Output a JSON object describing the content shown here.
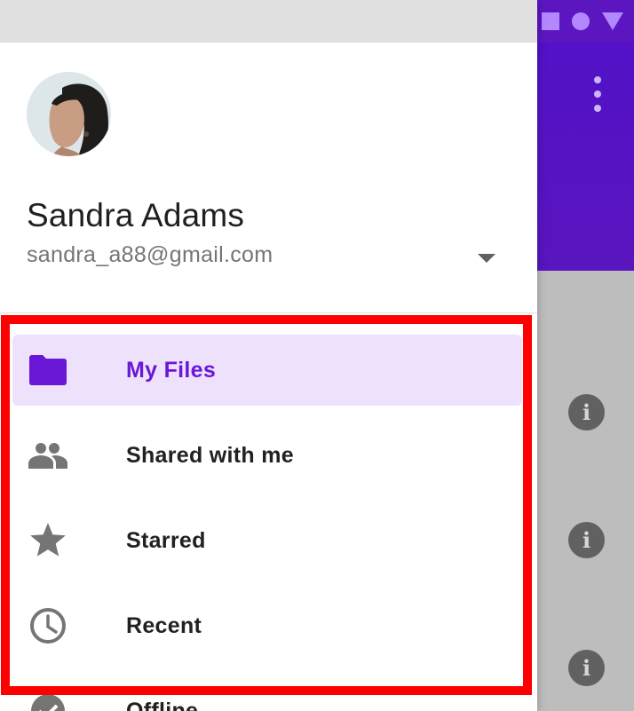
{
  "status_bar": {
    "icons": [
      "square-icon",
      "circle-icon",
      "triangle-icon"
    ]
  },
  "background": {
    "appbar_color": "#5311c8",
    "actions": [
      "more-vert-icon"
    ],
    "list_icons": [
      "info-icon",
      "info-icon",
      "info-icon"
    ]
  },
  "drawer": {
    "user": {
      "name": "Sandra Adams",
      "email": "sandra_a88@gmail.com"
    },
    "nav": {
      "items": [
        {
          "label": "My Files",
          "icon": "folder-icon",
          "active": true
        },
        {
          "label": "Shared with me",
          "icon": "people-icon",
          "active": false
        },
        {
          "label": "Starred",
          "icon": "star-icon",
          "active": false
        },
        {
          "label": "Recent",
          "icon": "clock-icon",
          "active": false
        },
        {
          "label": "Offline",
          "icon": "check-circle-icon",
          "active": false
        }
      ]
    }
  },
  "colors": {
    "accent": "#6a17d6",
    "active_bg": "#ede1fc",
    "highlight": "#ff0000"
  }
}
